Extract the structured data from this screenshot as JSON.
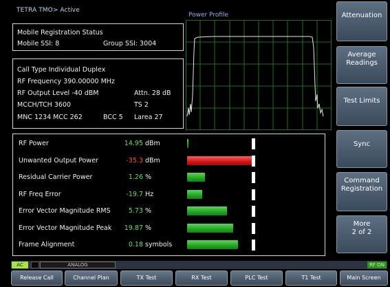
{
  "header": {
    "status": "TETRA TMO> Active"
  },
  "mobile": {
    "title": "Mobile Registration Status",
    "ssi": "Mobile SSI: 8",
    "group_ssi": "Group SSI: 3004"
  },
  "call": {
    "type": "Call Type  Individual Duplex",
    "freq": "RF Frequency 390.00000 MHz",
    "level": "RF Output Level  -40 dBM",
    "attn": "Attn.  28 dB",
    "mcch": "MCCH/TCH  3600",
    "ts": "TS  2",
    "mnc": "MNC 1234   MCC 262",
    "bcc": "BCC 5",
    "larea": "Larea  27"
  },
  "power_profile": {
    "title": "Power Profile"
  },
  "measurements": [
    {
      "label": "RF Power",
      "value": "14.95",
      "unit": "dBm",
      "color": "#6be06b",
      "bar": 0.02,
      "bar_color": "green"
    },
    {
      "label": "Unwanted Output Power",
      "value": "-35.3",
      "unit": "dBm",
      "color": "#ff4a4a",
      "bar": 1.0,
      "bar_color": "red"
    },
    {
      "label": "Residual Carrier Power",
      "value": "1.26",
      "unit": "%",
      "color": "#6be06b",
      "bar": 0.27,
      "bar_color": "green"
    },
    {
      "label": "RF Freq Error",
      "value": "-19.7",
      "unit": "Hz",
      "color": "#6be06b",
      "bar": 0.22,
      "bar_color": "green"
    },
    {
      "label": "Error Vector Magnitude RMS",
      "value": "5.73",
      "unit": "%",
      "color": "#6be06b",
      "bar": 0.59,
      "bar_color": "green"
    },
    {
      "label": "Error Vector Magnitude Peak",
      "value": "19.87",
      "unit": "%",
      "color": "#6be06b",
      "bar": 0.68,
      "bar_color": "green"
    },
    {
      "label": "Frame Alignment",
      "value": "0.18",
      "unit": "symbols",
      "color": "#6be06b",
      "bar": 0.75,
      "bar_color": "green"
    }
  ],
  "softkeys": [
    {
      "label": "Attenuation"
    },
    {
      "label": "Average\nReadings"
    },
    {
      "label": "Test Limits"
    },
    {
      "label": "Sync"
    },
    {
      "label": "Command\nRegistration"
    },
    {
      "label": "More\n2 of 2"
    }
  ],
  "statusbar": {
    "ac": "AC",
    "mode": "ANALOG",
    "rf": "RF ON"
  },
  "bottom_keys": [
    {
      "label": "Release Call"
    },
    {
      "label": "Channel Plan"
    },
    {
      "label": "TX Test"
    },
    {
      "label": "RX Test"
    },
    {
      "label": "PLC Test"
    },
    {
      "label": "T1 Test"
    },
    {
      "label": "Main Screen"
    }
  ]
}
